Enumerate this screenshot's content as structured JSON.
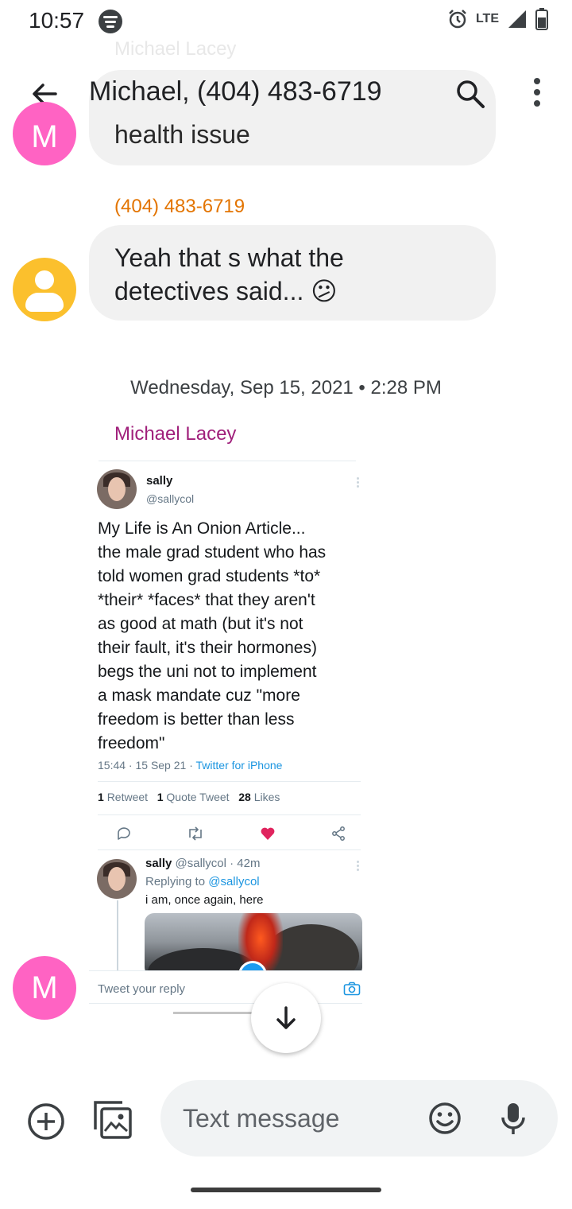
{
  "status_bar": {
    "time": "10:57",
    "network": "LTE"
  },
  "header": {
    "title": "Michael, (404) 483-6719"
  },
  "conversation": {
    "faded_sender": "Michael Lacey",
    "faded_bubble_text": "health issue",
    "phone_sender": "(404) 483-6719",
    "message_1": "Yeah that s what the\ndetectives said... 😕",
    "avatar_letter": "M",
    "date_separator": "Wednesday, Sep 15, 2021 • 2:28 PM",
    "sender_name": "Michael Lacey"
  },
  "tweet": {
    "name": "sally",
    "handle": "@sallycol",
    "body": "My Life is An Onion Article...\nthe male grad student who has\ntold women grad students *to*\n*their* *faces* that they aren't\nas good at math (but it's not\ntheir fault, it's their hormones)\nbegs the uni not to implement\na mask mandate cuz \"more\nfreedom is better than less\nfreedom\"",
    "timestamp": "15:44 · 15 Sep 21 · ",
    "source": "Twitter for iPhone",
    "retweets_count": "1",
    "retweets_label": "Retweet",
    "quotes_count": "1",
    "quotes_label": "Quote Tweet",
    "likes_count": "28",
    "likes_label": "Likes",
    "reply": {
      "name": "sally",
      "meta": " @sallycol · 42m",
      "replying_prefix": "Replying to ",
      "replying_handle": "@sallycol",
      "text": "i am, once again, here"
    },
    "reply_placeholder": "Tweet your reply"
  },
  "compose": {
    "placeholder": "Text message"
  },
  "colors": {
    "orange_sender": "#e37400",
    "magenta_sender": "#a0207b",
    "avatar_pink": "#ff63c3",
    "avatar_yellow": "#fbc02d",
    "twitter_blue": "#1b95e0",
    "like_red": "#e0245e"
  },
  "icons": {
    "back": "arrow-left-icon",
    "search": "search-icon",
    "more": "more-vert-icon",
    "scroll_down": "arrow-down-icon",
    "add": "add-circle-icon",
    "gallery": "gallery-icon",
    "emoji": "emoji-icon",
    "mic": "mic-icon"
  }
}
